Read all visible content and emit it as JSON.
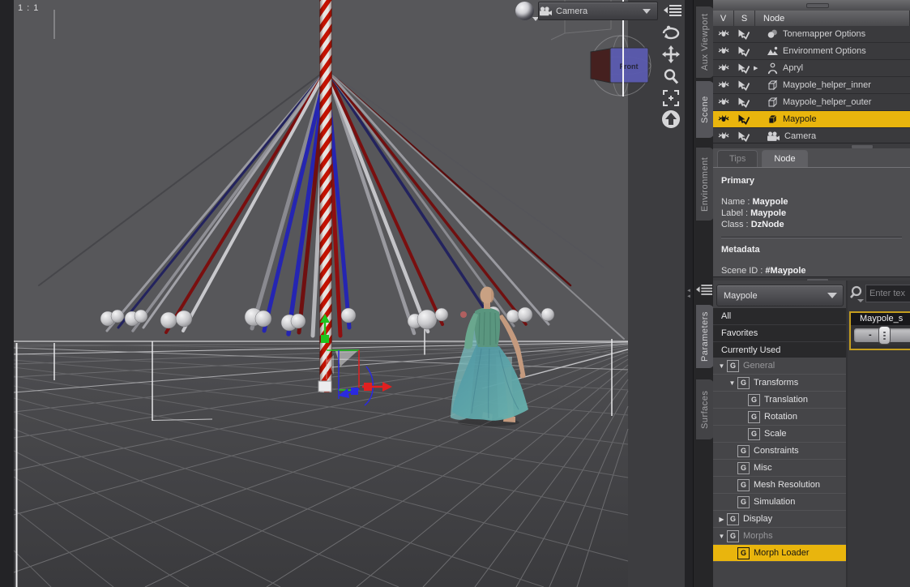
{
  "viewport": {
    "aspect_ratio_label": "1 : 1",
    "camera_selector": "Camera",
    "view_cube_front_label": "Front"
  },
  "dock_tabs": {
    "aux_viewport": "Aux Viewport",
    "scene": "Scene",
    "environment": "Environment",
    "parameters": "Parameters",
    "surfaces": "Surfaces"
  },
  "scene_panel": {
    "columns": [
      "V",
      "S",
      "Node"
    ],
    "rows": [
      {
        "label": "Tonemapper Options",
        "icon": "tonemapper-icon",
        "expander": false,
        "selected": false
      },
      {
        "label": "Environment Options",
        "icon": "environment-icon",
        "expander": false,
        "selected": false
      },
      {
        "label": "Apryl",
        "icon": "figure-icon",
        "expander": true,
        "selected": false
      },
      {
        "label": "Maypole_helper_inner",
        "icon": "cube-icon",
        "expander": false,
        "selected": false
      },
      {
        "label": "Maypole_helper_outer",
        "icon": "cube-icon",
        "expander": false,
        "selected": false
      },
      {
        "label": "Maypole",
        "icon": "cube-solid-icon",
        "expander": false,
        "selected": true
      },
      {
        "label": "Camera",
        "icon": "camera-icon",
        "expander": false,
        "selected": false
      }
    ]
  },
  "node_panel": {
    "tabs": [
      "Tips",
      "Node"
    ],
    "active_tab": "Node",
    "primary_heading": "Primary",
    "fields": [
      {
        "label": "Name :",
        "value": "Maypole"
      },
      {
        "label": "Label :",
        "value": "Maypole"
      },
      {
        "label": "Class :",
        "value": "DzNode"
      }
    ],
    "metadata_heading": "Metadata",
    "scene_id_label": "Scene ID :",
    "scene_id_value": "#Maypole"
  },
  "parameters_panel": {
    "node_selector": "Maypole",
    "filters": [
      "All",
      "Favorites",
      "Currently Used"
    ],
    "tree": [
      {
        "label": "General",
        "level": 0,
        "arrow": "down",
        "muted": true,
        "selected": false
      },
      {
        "label": "Transforms",
        "level": 1,
        "arrow": "down",
        "muted": false,
        "selected": false
      },
      {
        "label": "Translation",
        "level": 2,
        "arrow": "none",
        "muted": false,
        "selected": false
      },
      {
        "label": "Rotation",
        "level": 2,
        "arrow": "none",
        "muted": false,
        "selected": false
      },
      {
        "label": "Scale",
        "level": 2,
        "arrow": "none",
        "muted": false,
        "selected": false
      },
      {
        "label": "Constraints",
        "level": 1,
        "arrow": "none",
        "muted": false,
        "selected": false
      },
      {
        "label": "Misc",
        "level": 1,
        "arrow": "none",
        "muted": false,
        "selected": false
      },
      {
        "label": "Mesh Resolution",
        "level": 1,
        "arrow": "none",
        "muted": false,
        "selected": false
      },
      {
        "label": "Simulation",
        "level": 1,
        "arrow": "none",
        "muted": false,
        "selected": false
      },
      {
        "label": "Display",
        "level": 0,
        "arrow": "right",
        "muted": false,
        "selected": false
      },
      {
        "label": "Morphs",
        "level": 0,
        "arrow": "down",
        "muted": true,
        "selected": false
      },
      {
        "label": "Morph Loader",
        "level": 1,
        "arrow": "none",
        "muted": false,
        "selected": true
      }
    ],
    "search_placeholder": "Enter tex",
    "slider": {
      "label": "Maypole_s",
      "minus_label": "-"
    }
  },
  "colors": {
    "selection_yellow": "#e9b50d",
    "gizmo_green": "#1ec41e",
    "gizmo_red": "#e02020",
    "gizmo_blue": "#2a2ae0",
    "pole_red": "#c41200"
  }
}
